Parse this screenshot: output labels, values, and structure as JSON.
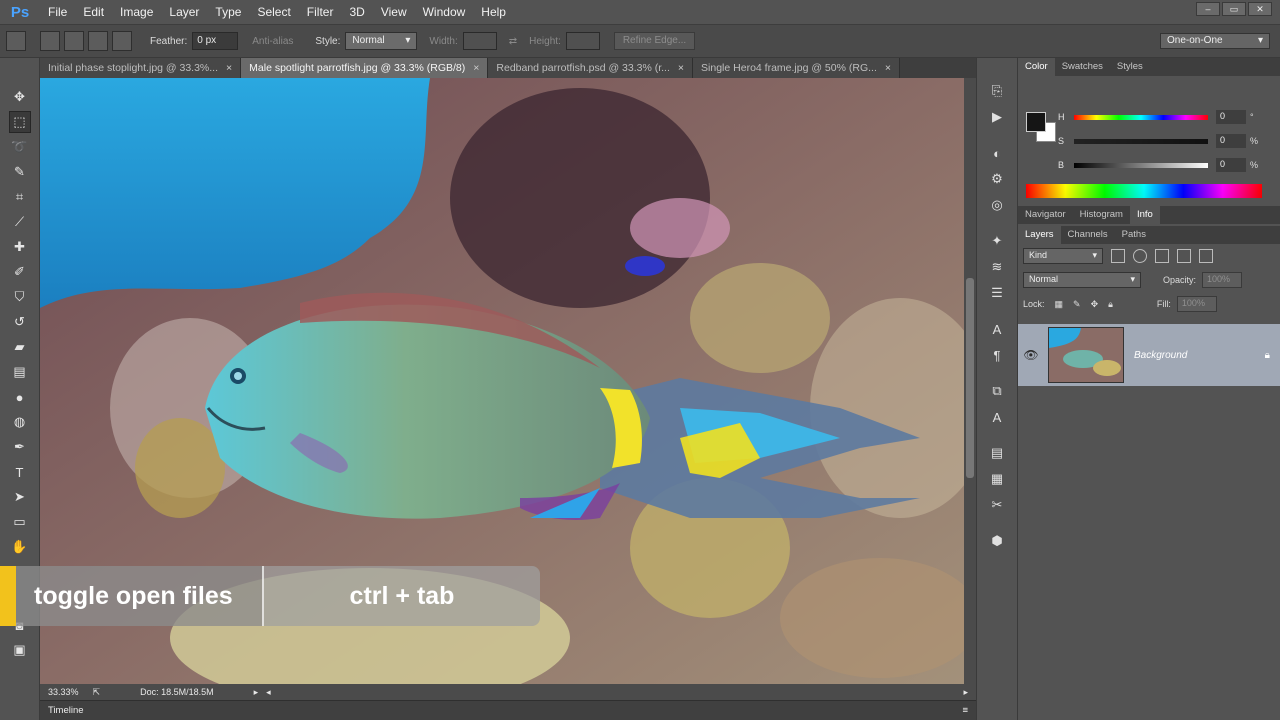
{
  "app": {
    "logo": "Ps"
  },
  "menu": [
    "File",
    "Edit",
    "Image",
    "Layer",
    "Type",
    "Select",
    "Filter",
    "3D",
    "View",
    "Window",
    "Help"
  ],
  "window_controls": [
    "–",
    "▭",
    "✕"
  ],
  "options": {
    "feather_label": "Feather:",
    "feather_value": "0 px",
    "antialias_label": "Anti-alias",
    "style_label": "Style:",
    "style_value": "Normal",
    "width_label": "Width:",
    "height_label": "Height:",
    "refine_edge": "Refine Edge...",
    "workspace": "One-on-One"
  },
  "tabs": [
    {
      "label": "Initial phase stoplight.jpg @ 33.3%...",
      "close": "×"
    },
    {
      "label": "Male spotlight parrotfish.jpg @ 33.3% (RGB/8)",
      "close": "×"
    },
    {
      "label": "Redband parrotfish.psd @ 33.3% (r...",
      "close": "×"
    },
    {
      "label": "Single Hero4 frame.jpg @ 50% (RG...",
      "close": "×"
    }
  ],
  "status": {
    "zoom": "33.33%",
    "doc": "Doc: 18.5M/18.5M"
  },
  "timeline": {
    "label": "Timeline"
  },
  "overlay": {
    "action": "toggle open files",
    "shortcut": "ctrl + tab"
  },
  "color_panel": {
    "tabs": [
      "Color",
      "Swatches",
      "Styles"
    ],
    "sliders": [
      {
        "label": "H",
        "value": "0",
        "unit": "°"
      },
      {
        "label": "S",
        "value": "0",
        "unit": "%"
      },
      {
        "label": "B",
        "value": "0",
        "unit": "%"
      }
    ]
  },
  "nav_tabs": [
    "Navigator",
    "Histogram",
    "Info"
  ],
  "layers_panel": {
    "tabs": [
      "Layers",
      "Channels",
      "Paths"
    ],
    "kind": "Kind",
    "blend_mode": "Normal",
    "opacity_label": "Opacity:",
    "opacity_value": "100%",
    "lock_label": "Lock:",
    "fill_label": "Fill:",
    "fill_value": "100%",
    "layer_name": "Background"
  },
  "colors": {
    "accent_yellow": "#f2c21c",
    "selected_layer": "#a0a8b5"
  }
}
